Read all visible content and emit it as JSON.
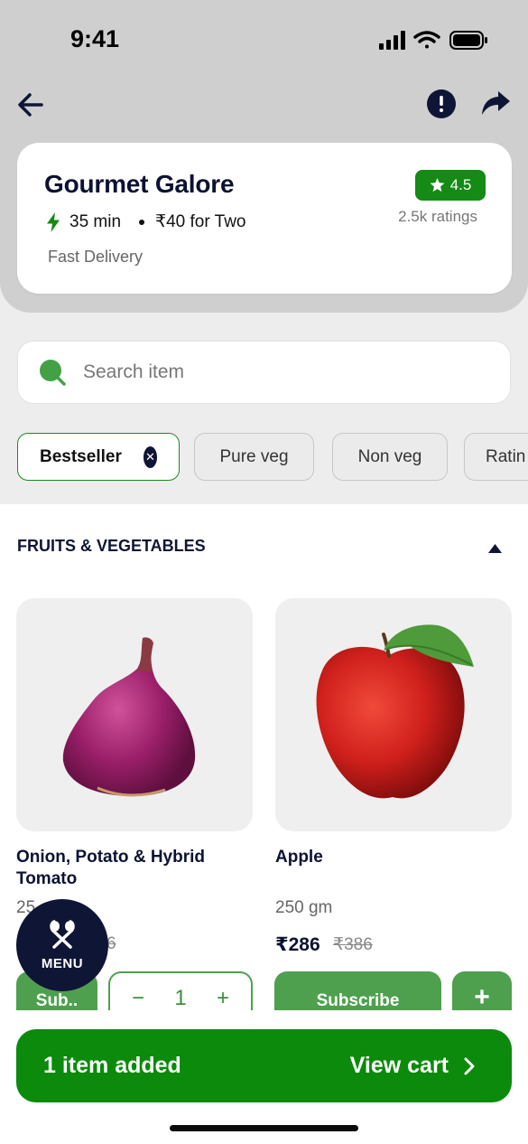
{
  "status_bar": {
    "time": "9:41"
  },
  "restaurant": {
    "name": "Gourmet Galore",
    "rating": "4.5",
    "ratings_count": "2.5k ratings",
    "delivery_time": "35 min",
    "price_for_two": "₹40 for Two",
    "tag": "Fast Delivery"
  },
  "search": {
    "placeholder": "Search item"
  },
  "filters": [
    {
      "label": "Bestseller",
      "active": true
    },
    {
      "label": "Pure veg",
      "active": false
    },
    {
      "label": "Non veg",
      "active": false
    },
    {
      "label": "Ratin",
      "active": false
    }
  ],
  "section": {
    "title": "FRUITS & VEGETABLES"
  },
  "products": [
    {
      "name": "Onion, Potato & Hybrid Tomato",
      "qty_partial": "25",
      "price_partial": "6",
      "subscribe_label": "Sub..",
      "stepper": {
        "minus": "−",
        "count": "1",
        "plus": "+"
      }
    },
    {
      "name": "Apple",
      "qty": "250 gm",
      "price": "₹286",
      "old_price": "₹386",
      "subscribe_label": "Subscribe",
      "add_label": "+"
    }
  ],
  "menu_fab": {
    "label": "MENU"
  },
  "cart": {
    "summary": "1 item added",
    "action": "View cart"
  },
  "colors": {
    "primary_green": "#0b8a0b",
    "button_green": "#4ea04e",
    "navy": "#0f1535",
    "header_gray": "#cfcfcf"
  },
  "icons": [
    "back-arrow-icon",
    "info-icon",
    "share-icon",
    "bolt-icon",
    "star-icon",
    "search-icon",
    "close-icon",
    "chevron-up-icon",
    "spoon-fork-icon",
    "chevron-right-icon"
  ]
}
